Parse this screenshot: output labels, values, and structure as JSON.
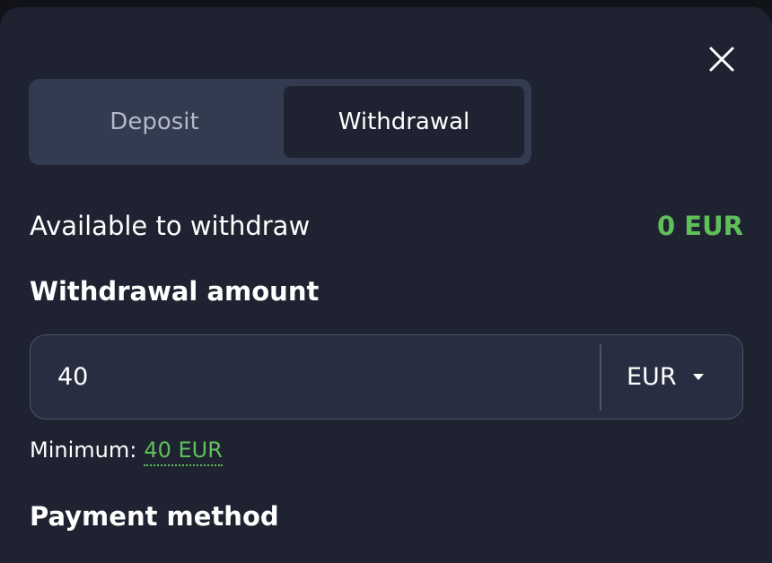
{
  "dialog": {
    "close_icon": "close-icon"
  },
  "tabs": [
    {
      "label": "Deposit",
      "active": false
    },
    {
      "label": "Withdrawal",
      "active": true
    }
  ],
  "available": {
    "label": "Available to withdraw",
    "value": "0 EUR"
  },
  "amount": {
    "label": "Withdrawal amount",
    "value": "40",
    "currency": "EUR"
  },
  "minimum": {
    "label": "Minimum:",
    "value": "40 EUR"
  },
  "payment": {
    "label": "Payment method"
  },
  "colors": {
    "accent_green": "#5fbf5a",
    "modal_bg": "#1f2331",
    "tab_bg": "#333b51",
    "input_bg": "#282e41"
  }
}
